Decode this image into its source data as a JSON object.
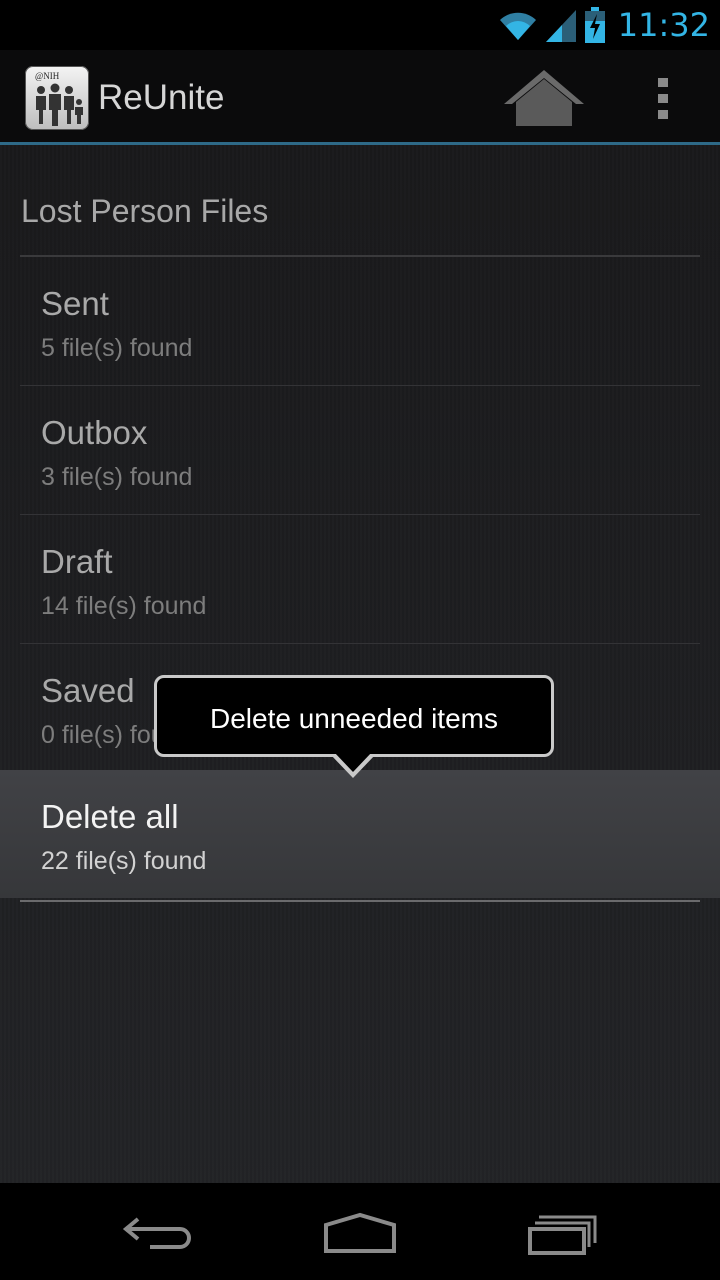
{
  "status_bar": {
    "time": "11:32",
    "icons": [
      "wifi-icon",
      "signal-icon",
      "battery-charging-icon"
    ],
    "accent_color": "#33b5e5"
  },
  "action_bar": {
    "app_title": "ReUnite",
    "app_icon": "reunite-nih-logo",
    "logo_text": "@NIH",
    "home_icon": "home-icon",
    "overflow_icon": "overflow-menu-icon"
  },
  "section": {
    "title": "Lost Person Files"
  },
  "list": {
    "items": [
      {
        "title": "Sent",
        "subtitle": "5 file(s) found"
      },
      {
        "title": "Outbox",
        "subtitle": "3 file(s) found"
      },
      {
        "title": "Draft",
        "subtitle": "14 file(s) found"
      },
      {
        "title": "Saved",
        "subtitle": "0 file(s) found"
      },
      {
        "title": "Delete all",
        "subtitle": "22 file(s) found"
      }
    ]
  },
  "tooltip": {
    "text": "Delete unneeded items"
  },
  "nav_bar": {
    "icons": [
      "back-icon",
      "home-nav-icon",
      "recent-apps-icon"
    ]
  }
}
